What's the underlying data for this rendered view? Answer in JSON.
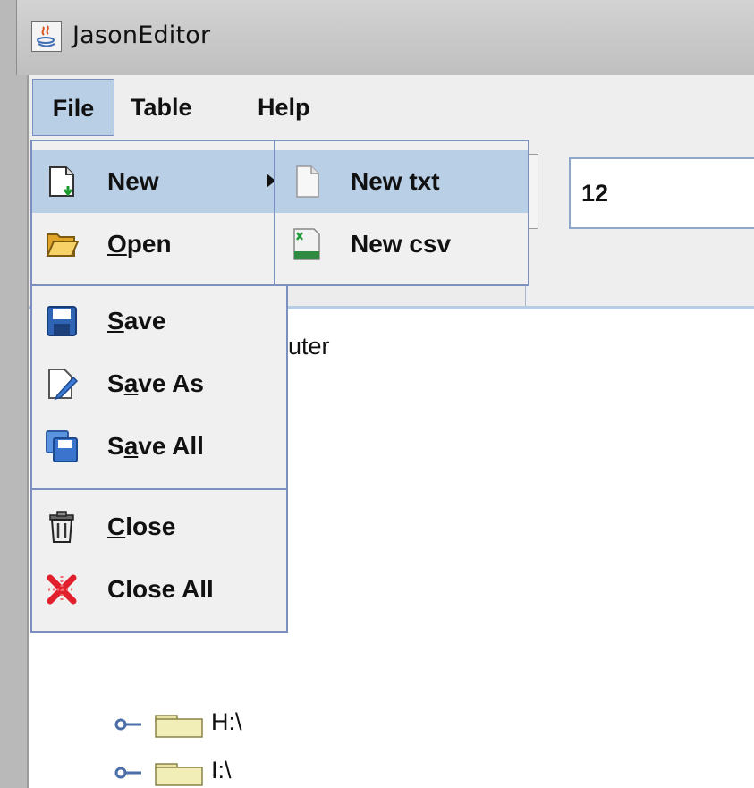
{
  "window": {
    "title": "JasonEditor"
  },
  "menubar": {
    "file": "File",
    "table": "Table",
    "help": "Help"
  },
  "toolbar": {
    "path_value": "12"
  },
  "tree": {
    "root_label_visible": "uter",
    "drives": [
      {
        "label": "H:\\"
      },
      {
        "label": "I:\\"
      }
    ]
  },
  "file_menu": {
    "new": {
      "label": "New",
      "icon": "new-file-icon"
    },
    "open": {
      "pre": "",
      "mnemonic": "O",
      "post": "pen",
      "icon": "open-folder-icon"
    },
    "save": {
      "pre": "",
      "mnemonic": "S",
      "post": "ave",
      "icon": "floppy-disk-icon"
    },
    "save_as": {
      "pre": "S",
      "mnemonic": "a",
      "post": "ve As",
      "icon": "save-as-icon"
    },
    "save_all": {
      "pre": "S",
      "mnemonic": "a",
      "post": "ve All",
      "icon": "save-all-icon"
    },
    "close": {
      "pre": "",
      "mnemonic": "C",
      "post": "lose",
      "icon": "trash-icon"
    },
    "close_all": {
      "label": "Close All",
      "icon": "close-all-icon"
    }
  },
  "new_submenu": {
    "new_txt": {
      "label": "New txt",
      "icon": "text-file-icon"
    },
    "new_csv": {
      "label": "New csv",
      "icon": "csv-file-icon"
    }
  },
  "colors": {
    "selection": "#b8cfe5",
    "menu_border": "#7b8fc2",
    "menu_bg": "#f0f0f0"
  }
}
